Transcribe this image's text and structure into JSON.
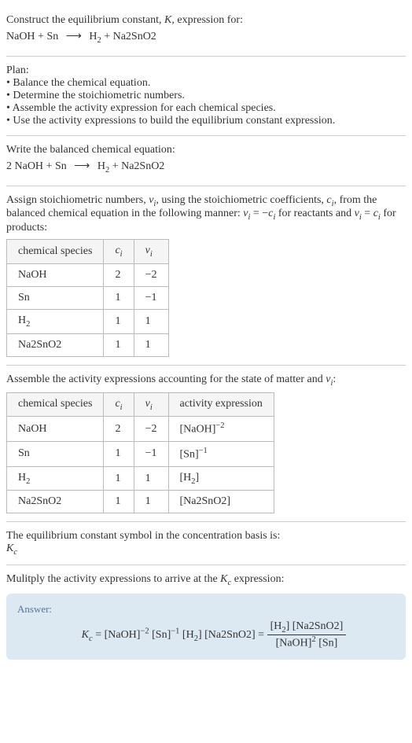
{
  "title_line1": "Construct the equilibrium constant, ",
  "title_K": "K",
  "title_line1b": ", expression for:",
  "eq1": {
    "lhs": "NaOH + Sn",
    "arrow": "⟶",
    "rhs_h2": "H",
    "rhs_h2_sub": "2",
    "rhs_plus": " + Na2SnO2"
  },
  "plan": {
    "header": "Plan:",
    "items": [
      "Balance the chemical equation.",
      "Determine the stoichiometric numbers.",
      "Assemble the activity expression for each chemical species.",
      "Use the activity expressions to build the equilibrium constant expression."
    ]
  },
  "balanced": {
    "header": "Write the balanced chemical equation:",
    "lhs": "2 NaOH + Sn",
    "arrow": "⟶",
    "rhs_h2": "H",
    "rhs_h2_sub": "2",
    "rhs_plus": " + Na2SnO2"
  },
  "stoich": {
    "text_a": "Assign stoichiometric numbers, ",
    "nu_i": "ν",
    "sub_i": "i",
    "text_b": ", using the stoichiometric coefficients, ",
    "c_i": "c",
    "text_c": ", from the balanced chemical equation in the following manner: ",
    "rel1a": "ν",
    "rel1b": " = −",
    "rel1c": "c",
    "text_d": " for reactants and ",
    "rel2a": "ν",
    "rel2b": " = ",
    "rel2c": "c",
    "text_e": " for products:"
  },
  "table1": {
    "h1": "chemical species",
    "h2": "c",
    "h2sub": "i",
    "h3": "ν",
    "h3sub": "i",
    "rows": [
      {
        "sp": "NaOH",
        "c": "2",
        "v": "−2"
      },
      {
        "sp": "Sn",
        "c": "1",
        "v": "−1"
      },
      {
        "sp": "H",
        "spsub": "2",
        "c": "1",
        "v": "1"
      },
      {
        "sp": "Na2SnO2",
        "c": "1",
        "v": "1"
      }
    ]
  },
  "assemble": {
    "text_a": "Assemble the activity expressions accounting for the state of matter and ",
    "nu": "ν",
    "sub_i": "i",
    "colon": ":"
  },
  "table2": {
    "h1": "chemical species",
    "h2": "c",
    "h2sub": "i",
    "h3": "ν",
    "h3sub": "i",
    "h4": "activity expression",
    "rows": [
      {
        "sp": "NaOH",
        "c": "2",
        "v": "−2",
        "act": "[NaOH]",
        "actsup": "−2"
      },
      {
        "sp": "Sn",
        "c": "1",
        "v": "−1",
        "act": "[Sn]",
        "actsup": "−1"
      },
      {
        "sp": "H",
        "spsub": "2",
        "c": "1",
        "v": "1",
        "act": "[H",
        "actsub": "2",
        "actclose": "]"
      },
      {
        "sp": "Na2SnO2",
        "c": "1",
        "v": "1",
        "act": "[Na2SnO2]"
      }
    ]
  },
  "basis": {
    "text": "The equilibrium constant symbol in the concentration basis is:",
    "Kc": "K",
    "Kc_sub": "c"
  },
  "multiply": {
    "text_a": "Mulitply the activity expressions to arrive at the ",
    "Kc": "K",
    "Kc_sub": "c",
    "text_b": " expression:"
  },
  "answer": {
    "label": "Answer:",
    "Kc": "K",
    "Kc_sub": "c",
    "eq": " = [NaOH]",
    "p1sup": "−2",
    "p2": " [Sn]",
    "p2sup": "−1",
    "p3": " [H",
    "p3sub": "2",
    "p3b": "] [Na2SnO2] = ",
    "num": "[H",
    "numsub": "2",
    "numb": "] [Na2SnO2]",
    "den": "[NaOH]",
    "densup": "2",
    "denb": " [Sn]"
  }
}
